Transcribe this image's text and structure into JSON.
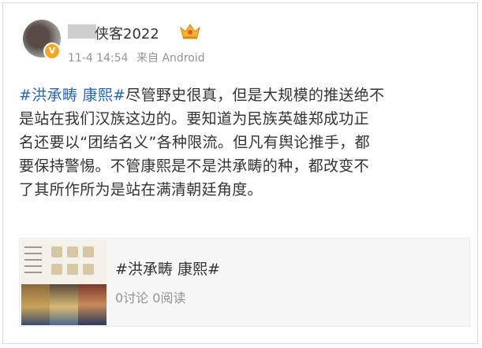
{
  "post": {
    "username": "侠客2022",
    "meta": {
      "time": "11-4 14:54",
      "source": "来自 Android"
    },
    "content": {
      "line1_tag": "#洪承畴 康熙#",
      "line1_text": "尽管野史很真，但是大规模的推送绝不",
      "line2": "是站在我们汉族这边的。要知道为民族英雄郑成功正",
      "line3": "名还要以“团结名义”各种限流。但凡有舆论推手，都",
      "line4": "要保持警惕。不管康熙是不是洪承畴的种，都改变不",
      "line5": "了其所作所为是站在满清朝廷角度。"
    },
    "topic_card": {
      "title": "#洪承畴 康熙#",
      "stats": "0讨论 0阅读"
    }
  },
  "icons": {
    "verified_badge": "verified-v-icon",
    "crown": "crown-icon"
  },
  "colors": {
    "tag": "#2566b8",
    "text": "#333333",
    "meta": "#939393",
    "verified": "#f5a623"
  }
}
